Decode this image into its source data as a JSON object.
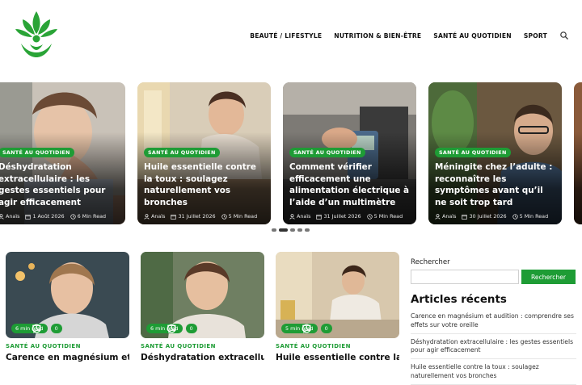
{
  "header": {
    "logo_alt": "",
    "nav": [
      {
        "label": "BEAUTÉ / LIFESTYLE"
      },
      {
        "label": "NUTRITION & BIEN-ÊTRE"
      },
      {
        "label": "SANTÉ AU QUOTIDIEN"
      },
      {
        "label": "SPORT"
      }
    ]
  },
  "colors": {
    "brand": "#1e9c35"
  },
  "slider": {
    "slides": [
      {
        "category": "SANTÉ AU QUOTIDIEN",
        "title": "Déshydratation extracellulaire : les gestes essentiels pour agir efficacement",
        "author": "Anaïs",
        "date": "1 Août 2026",
        "read": "6 Min Read"
      },
      {
        "category": "SANTÉ AU QUOTIDIEN",
        "title": "Huile essentielle contre la toux : soulagez naturellement vos bronches",
        "author": "Anaïs",
        "date": "31 Juillet 2026",
        "read": "5 Min Read"
      },
      {
        "category": "SANTÉ AU QUOTIDIEN",
        "title": "Comment vérifier efficacement une alimentation électrique à l’aide d’un multimètre",
        "author": "Anaïs",
        "date": "31 Juillet 2026",
        "read": "5 Min Read"
      },
      {
        "category": "SANTÉ AU QUOTIDIEN",
        "title": "Méningite chez l’adulte : reconnaître les symptômes avant qu’il ne soit trop tard",
        "author": "Anaïs",
        "date": "30 Juillet 2026",
        "read": "5 Min Read"
      }
    ],
    "dots": 5,
    "active_dot": 1
  },
  "cards": [
    {
      "read": "6 min read",
      "comments": "0",
      "category": "SANTÉ AU QUOTIDIEN",
      "title": "Carence en magnésium et"
    },
    {
      "read": "6 min read",
      "comments": "0",
      "category": "SANTÉ AU QUOTIDIEN",
      "title": "Déshydratation extracellulaire"
    },
    {
      "read": "5 min read",
      "comments": "0",
      "category": "SANTÉ AU QUOTIDIEN",
      "title": "Huile essentielle contre la toux"
    }
  ],
  "sidebar": {
    "search_label": "Rechercher",
    "search_value": "",
    "search_button": "Rechercher",
    "recent_heading": "Articles récents",
    "recent": [
      "Carence en magnésium et audition : comprendre ses effets sur votre oreille",
      "Déshydratation extracellulaire : les gestes essentiels pour agir efficacement",
      "Huile essentielle contre la toux : soulagez naturellement vos bronches"
    ]
  }
}
